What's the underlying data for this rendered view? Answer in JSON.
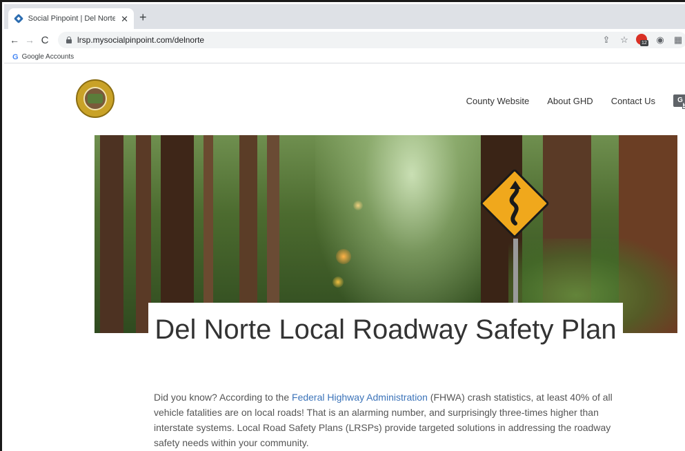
{
  "browser": {
    "tab": {
      "title": "Social Pinpoint | Del Norte LRSP",
      "close_glyph": "✕",
      "favicon": "social-pinpoint-favicon"
    },
    "new_tab_glyph": "+",
    "nav": {
      "back_glyph": "←",
      "forward_glyph": "→",
      "reload_glyph": "C"
    },
    "address_bar": {
      "url": "lrsp.mysocialpinpoint.com/delnorte"
    },
    "toolbar_icons": [
      {
        "name": "share-icon",
        "glyph": "⇪"
      },
      {
        "name": "bookmark-star-icon",
        "glyph": "☆"
      },
      {
        "name": "extension-badge-icon",
        "count": "12"
      },
      {
        "name": "extension-icon",
        "glyph": "◉"
      },
      {
        "name": "calendar-extension-icon",
        "glyph": "▦"
      }
    ],
    "bookmarks": [
      {
        "icon": "google-g-icon",
        "label": "Google Accounts",
        "glyph": "G"
      }
    ]
  },
  "site": {
    "logo": "county-of-del-norte-seal",
    "nav": {
      "links": [
        "County Website",
        "About GHD",
        "Contact Us"
      ],
      "translate": {
        "icon": "google-translate-icon",
        "glyph": "G",
        "sub_glyph": "文"
      }
    },
    "hero": {
      "image": "redwood-forest-curve-road-sign"
    },
    "title": "Del Norte Local Roadway Safety Plan",
    "intro": {
      "before_link": "Did you know? According to the ",
      "link_text": "Federal Highway Administration",
      "after_link": " (FHWA) crash statistics, at least 40% of all vehicle fatalities are on local roads! That is an alarming number, and surprisingly three-times higher than interstate systems. Local Road Safety Plans (LRSPs) provide targeted solutions in addressing the roadway safety needs within your community."
    }
  },
  "colors": {
    "link": "#3b73b9",
    "text": "#333333",
    "body_text": "#555555",
    "sign": "#f0a81c"
  }
}
